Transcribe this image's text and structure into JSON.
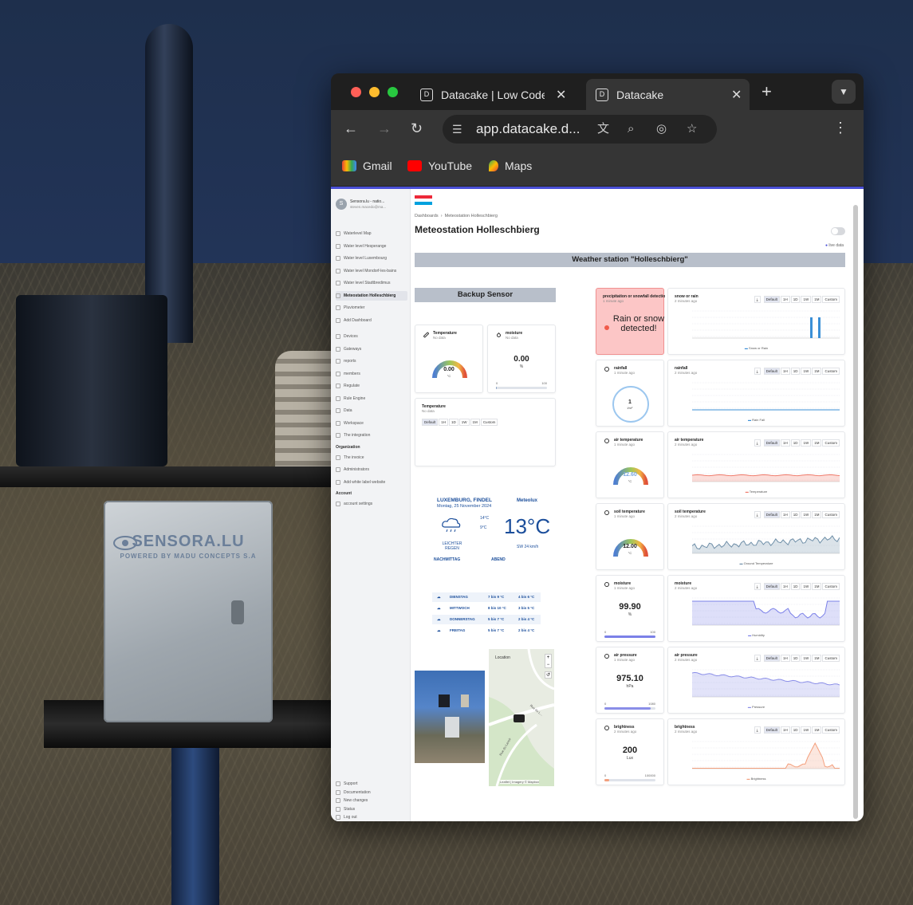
{
  "background": {
    "box_brand": "SENSORA.LU",
    "box_tagline": "POWERED BY MADU CONCEPTS S.A"
  },
  "browser": {
    "tabs": [
      {
        "title": "Datacake | Low Code",
        "active": false
      },
      {
        "title": "Datacake",
        "active": true
      }
    ],
    "url": "app.datacake.d...",
    "bookmarks": [
      "Gmail",
      "YouTube",
      "Maps"
    ]
  },
  "sidebar": {
    "account_name": "Sensora.lu - natio...",
    "account_email": "steven.macedo@ma...",
    "avatar_letter": "S",
    "dashboards": [
      "Waterlevel Map",
      "Water level Hesperange",
      "Water level Luxembourg",
      "Water level Mondorf-les-bains",
      "Water level Stadtbredimus",
      "Meteostation Holleschbierg",
      "Pluviometer",
      "Add Dashboard"
    ],
    "nav": [
      "Devices",
      "Gateways",
      "reports",
      "members",
      "Regulate",
      "Rule Engine",
      "Data",
      "Workspace",
      "The integration"
    ],
    "org_heading": "Organization",
    "org": [
      "The invoice",
      "Administrators",
      "Add white label website"
    ],
    "account_heading": "Account",
    "account": [
      "account settings"
    ],
    "footer": [
      "Support",
      "Documentation",
      "New changes",
      "Status",
      "Log out"
    ]
  },
  "page": {
    "breadcrumb_root": "Dashboards",
    "breadcrumb_current": "Meteostation Holleschbierg",
    "title": "Meteostation Holleschbierg",
    "live_label": "live data",
    "banner": "Weather station \"Holleschbierg\"",
    "backup_banner": "Backup Sensor"
  },
  "time_ranges": [
    "Default",
    "1H",
    "1D",
    "1W",
    "1M",
    "Custom"
  ],
  "backup": {
    "temp": {
      "title": "Temperature",
      "sub": "No data",
      "value": "0.00",
      "unit": "°C"
    },
    "moist": {
      "title": "moisture",
      "sub": "No data",
      "value": "0.00",
      "unit": "%",
      "min": "0",
      "max": "100"
    },
    "temp_chart": {
      "title": "Temperature",
      "sub": "No data"
    }
  },
  "weather_widget": {
    "city": "LUXEMBURG, FINDEL",
    "date": "Montag, 25 November 2024",
    "logo": "Meteolux",
    "temp": "13°C",
    "hi": "14°C",
    "lo": "9°C",
    "condition": "LEICHTER REGEN",
    "wind": "SW 24 km/h",
    "afternoon": "NACHMITTAG",
    "evening": "ABEND",
    "days": [
      {
        "day": "DIENSTAG",
        "a": "7 bis 9 °C",
        "b": "4 bis 6 °C"
      },
      {
        "day": "MITTWOCH",
        "a": "8 bis 10 °C",
        "b": "3 bis 5 °C"
      },
      {
        "day": "DONNERSTAG",
        "a": "5 bis 7 °C",
        "b": "2 bis 4 °C"
      },
      {
        "day": "FREITAG",
        "a": "5 bis 7 °C",
        "b": "2 bis 4 °C"
      }
    ]
  },
  "map": {
    "label": "Location",
    "attribution": "Leaflet | Imagery © Mapbox",
    "street1": "Rue du L...",
    "street2": "Rue du Lavoir"
  },
  "widgets": [
    {
      "key": "precip",
      "title": "precipitation or snowfall detection",
      "sub": "1 minute ago",
      "alarm_text": "Rain or snow detected!",
      "chart_title": "snow or rain",
      "chart_sub": "2 minutes ago",
      "legend": "Snow or Rain"
    },
    {
      "key": "rainfall",
      "title": "rainfall",
      "sub": "1 minute ago",
      "value": "1",
      "unit": "l/m²",
      "chart_title": "rainfall",
      "chart_sub": "2 minutes ago",
      "legend": "Rain Fall"
    },
    {
      "key": "airtemp",
      "title": "air temperature",
      "sub": "1 minute ago",
      "value": "12.60",
      "unit": "°C",
      "chart_title": "air temperature",
      "chart_sub": "2 minutes ago",
      "legend": "Temperature"
    },
    {
      "key": "soiltemp",
      "title": "soil temperature",
      "sub": "1 minute ago",
      "value": "12.00",
      "unit": "°C",
      "chart_title": "soil temperature",
      "chart_sub": "2 minutes ago",
      "legend": "Ground Temperature"
    },
    {
      "key": "moisture",
      "title": "moisture",
      "sub": "1 minute ago",
      "value": "99.90",
      "unit": "%",
      "min": "0",
      "max": "100",
      "chart_title": "moisture",
      "chart_sub": "2 minutes ago",
      "legend": "Humidity"
    },
    {
      "key": "pressure",
      "title": "air pressure",
      "sub": "1 minute ago",
      "value": "975.10",
      "unit": "hPa",
      "min": "0",
      "max": "1080",
      "chart_title": "air pressure",
      "chart_sub": "2 minutes ago",
      "legend": "Pressure"
    },
    {
      "key": "brightness",
      "title": "brightness",
      "sub": "2 minutes ago",
      "value": "200",
      "unit": "Lux",
      "min": "0",
      "max": "100000",
      "chart_title": "brightness",
      "chart_sub": "2 minutes ago",
      "legend": "Brightness"
    }
  ],
  "colors": {
    "accent": "#4a4fd6",
    "rain": "#3b8fd6",
    "temp": "#f07b6b",
    "soil": "#6f8fa8",
    "humidity": "#7b80e8",
    "pressure": "#8a8ee8",
    "brightness": "#f3a07e"
  }
}
